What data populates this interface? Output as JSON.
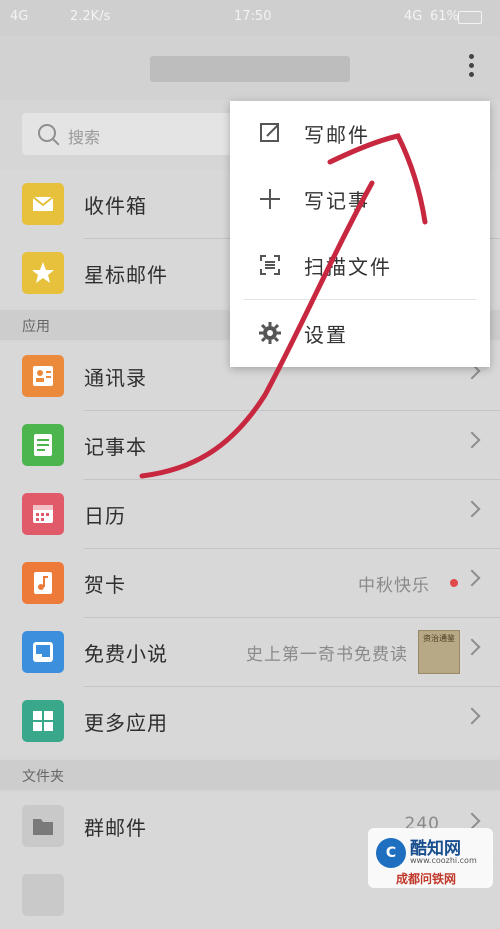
{
  "status_bar": {
    "network": "4G",
    "speed": "2.2K/s",
    "time": "17:50",
    "network_right": "4G",
    "battery": "61%"
  },
  "search": {
    "placeholder": "搜索"
  },
  "mail_items": [
    {
      "label": "收件箱",
      "icon": "inbox-icon",
      "color": "#e7c13c"
    },
    {
      "label": "星标邮件",
      "icon": "star-icon",
      "color": "#e7c13c"
    }
  ],
  "section_apps": "应用",
  "app_items": [
    {
      "label": "通讯录",
      "icon": "contacts-icon",
      "color": "#ec8a3b",
      "sub": ""
    },
    {
      "label": "记事本",
      "icon": "notepad-icon",
      "color": "#4cb54e",
      "sub": ""
    },
    {
      "label": "日历",
      "icon": "calendar-icon",
      "color": "#e05a6a",
      "sub": ""
    },
    {
      "label": "贺卡",
      "icon": "greeting-card-icon",
      "color": "#ee7a3a",
      "sub": "中秋快乐"
    },
    {
      "label": "免费小说",
      "icon": "novel-icon",
      "color": "#3b8fdc",
      "sub": "史上第一奇书免费读",
      "thumb_text": "资治通鉴"
    },
    {
      "label": "更多应用",
      "icon": "more-apps-icon",
      "color": "#39a88a",
      "sub": ""
    }
  ],
  "section_folders": "文件夹",
  "folder_items": [
    {
      "label": "群邮件",
      "icon": "folder-icon",
      "sub": "240"
    }
  ],
  "menu": {
    "items": [
      {
        "label": "写邮件",
        "icon": "compose-icon"
      },
      {
        "label": "写记事",
        "icon": "plus-icon"
      },
      {
        "label": "扫描文件",
        "icon": "scan-icon"
      },
      {
        "label": "设置",
        "icon": "gear-icon"
      }
    ]
  },
  "watermark": {
    "name": "酷知网",
    "url": "www.coozhi.com",
    "city": "成都问铁网"
  },
  "colors": {
    "annotation_stroke": "#c8283f",
    "menu_bg": "#ffffff",
    "overlay_bg": "#d8d8d8"
  }
}
